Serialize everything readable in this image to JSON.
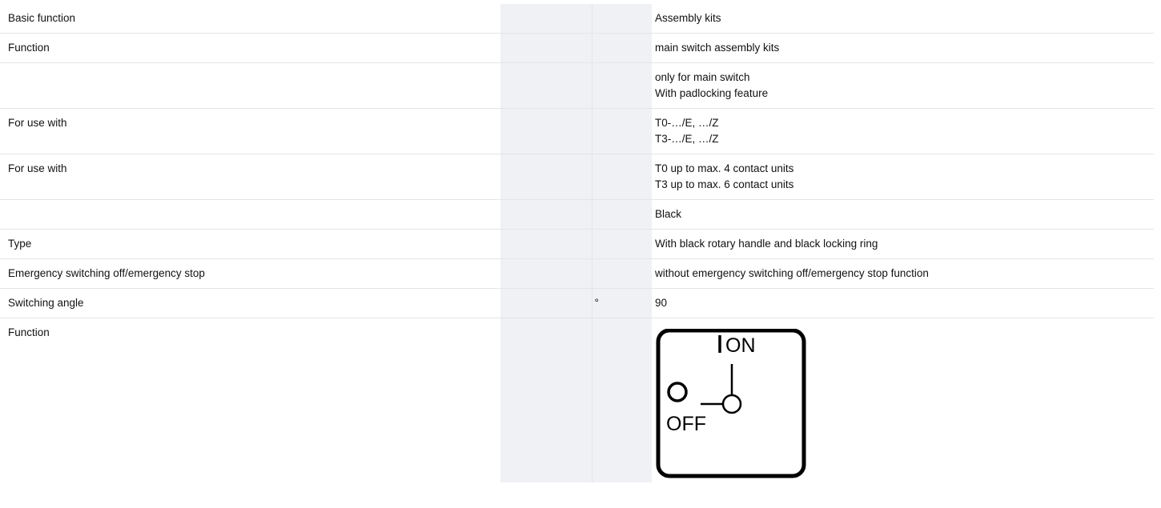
{
  "rows": [
    {
      "label": "Basic function",
      "unit": "",
      "value": [
        "Assembly kits"
      ]
    },
    {
      "label": "Function",
      "unit": "",
      "value": [
        "main switch assembly kits"
      ]
    },
    {
      "label": "",
      "unit": "",
      "value": [
        "only for main switch",
        "With padlocking feature"
      ]
    },
    {
      "label": "For use with",
      "unit": "",
      "value": [
        "T0-…/E, …/Z",
        "T3-…/E, …/Z"
      ]
    },
    {
      "label": "For use with",
      "unit": "",
      "value": [
        "T0 up to max. 4 contact units",
        "T3 up to max. 6 contact units"
      ]
    },
    {
      "label": "",
      "unit": "",
      "value": [
        "Black"
      ]
    },
    {
      "label": "Type",
      "unit": "",
      "value": [
        "With black rotary handle and black locking ring"
      ]
    },
    {
      "label": "Emergency switching off/emergency stop",
      "unit": "",
      "value": [
        "without emergency switching off/emergency stop function"
      ]
    },
    {
      "label": "Switching angle",
      "unit": "°",
      "value": [
        "90"
      ]
    },
    {
      "label": "Function",
      "unit": ""
    }
  ],
  "switch_symbol": {
    "icon": "rotary-switch-off-on-icon",
    "on_label": "ON",
    "off_label": "OFF"
  }
}
